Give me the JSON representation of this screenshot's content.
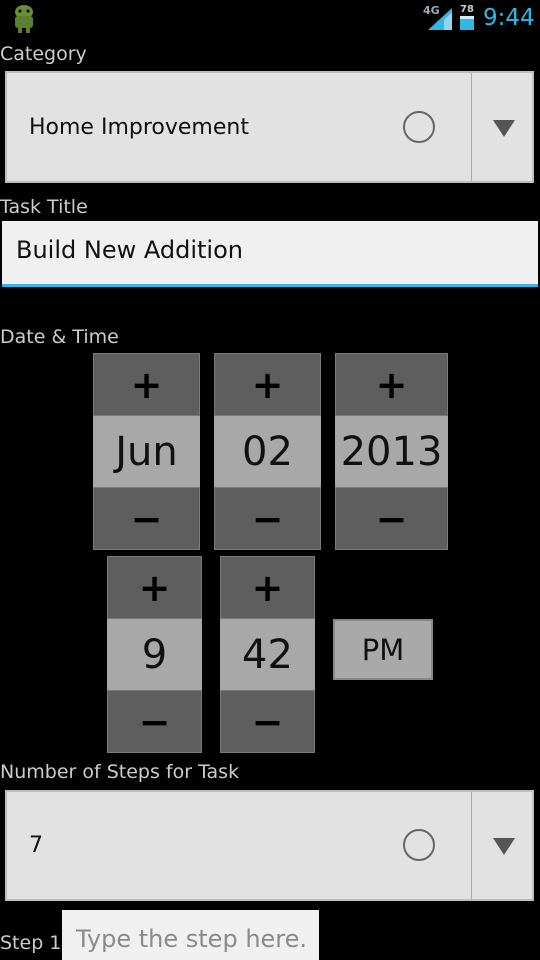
{
  "status_bar": {
    "network": "4G",
    "battery": "78",
    "time": "9:44",
    "icons": [
      "android-app-icon",
      "signal-icon",
      "battery-icon"
    ]
  },
  "category": {
    "label": "Category",
    "selected": "Home Improvement"
  },
  "task_title": {
    "label": "Task Title",
    "value": "Build New Addition"
  },
  "date_time": {
    "label": "Date & Time",
    "month": "Jun",
    "day": "02",
    "year": "2013",
    "hour": "9",
    "minute": "42",
    "ampm": "PM",
    "plus": "+",
    "minus": "−"
  },
  "steps": {
    "label": "Number of Steps for Task",
    "selected": "7"
  },
  "step1": {
    "label": "Step 1",
    "placeholder": "Type the step here."
  },
  "colors": {
    "accent": "#33b5e5",
    "background": "#000000",
    "spinner_bg": "#e2e2e2",
    "picker_button": "#5e5e5e",
    "picker_value": "#a8a8a8"
  }
}
